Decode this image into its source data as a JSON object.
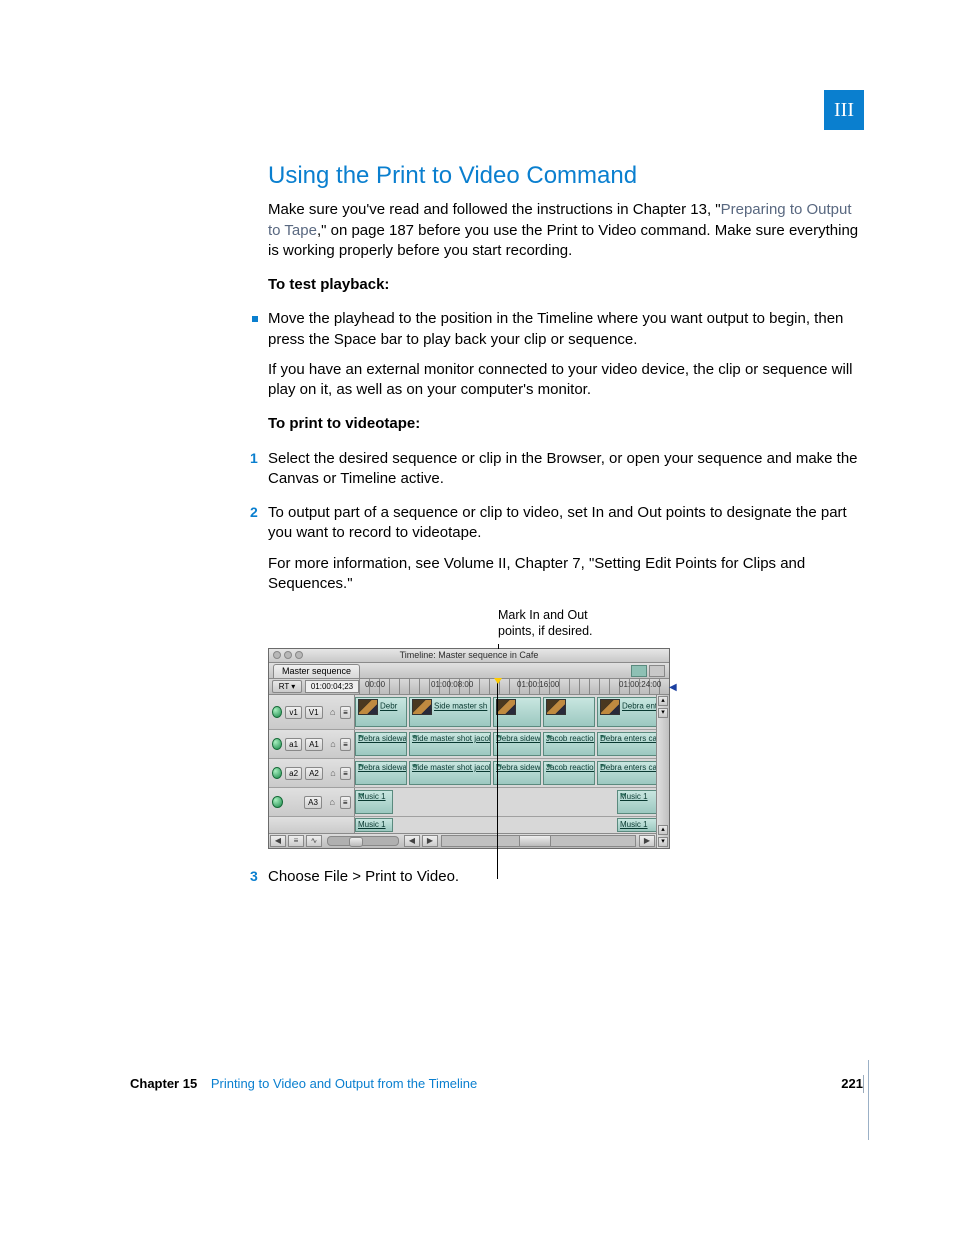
{
  "tab_marker": "III",
  "heading": "Using the Print to Video Command",
  "intro": {
    "p1a": "Make sure you've read and followed the instructions in Chapter 13, \"",
    "link": "Preparing to Output to Tape",
    "p1b": ",\" on page 187 before you use the Print to Video command. Make sure everything is working properly before you start recording."
  },
  "test_playback_heading": "To test playback:",
  "test_playback_bullet": "Move the playhead to the position in the Timeline where you want output to begin, then press the Space bar to play back your clip or sequence.",
  "test_playback_after": "If you have an external monitor connected to your video device, the clip or sequence will play on it, as well as on your computer's monitor.",
  "print_heading": "To print to videotape:",
  "step1": "Select the desired sequence or clip in the Browser, or open your sequence and make the Canvas or Timeline active.",
  "step2": "To output part of a sequence or clip to video, set In and Out points to designate the part you want to record to videotape.",
  "step2_after": "For more information, see Volume II, Chapter 7, \"Setting Edit Points for Clips and Sequences.\"",
  "annotation_line1": "Mark In and Out",
  "annotation_line2": "points, if desired.",
  "step3": "Choose File > Print to Video.",
  "timeline": {
    "title": "Timeline: Master sequence in Cafe",
    "tab": "Master sequence",
    "rt_label": "RT ▾",
    "timecode": "01:00:04;23",
    "ruler": {
      "t0": "00:00",
      "t1": "01:00:08:00",
      "t2": "01:00:16:00",
      "t3": "01:00:24:00"
    },
    "tracks": {
      "v1_a": "v1",
      "v1_b": "V1",
      "a1_a": "a1",
      "a1_b": "A1",
      "a2_a": "a2",
      "a2_b": "A2",
      "a3_b": "A3"
    },
    "clips": {
      "v": {
        "c1": "Debr",
        "c2": "Side master sh",
        "c5": "Debra enter"
      },
      "a": {
        "c1": "Debra sidewalking",
        "c2": "Side master shot jacob MS",
        "c3": "Debra sidewa",
        "c4": "Jacob reaction",
        "c5": "Debra enters cafe WS"
      },
      "m": "Music 1"
    }
  },
  "footer": {
    "chapter_label": "Chapter 15",
    "chapter_title": "Printing to Video and Output from the Timeline",
    "page": "221"
  }
}
